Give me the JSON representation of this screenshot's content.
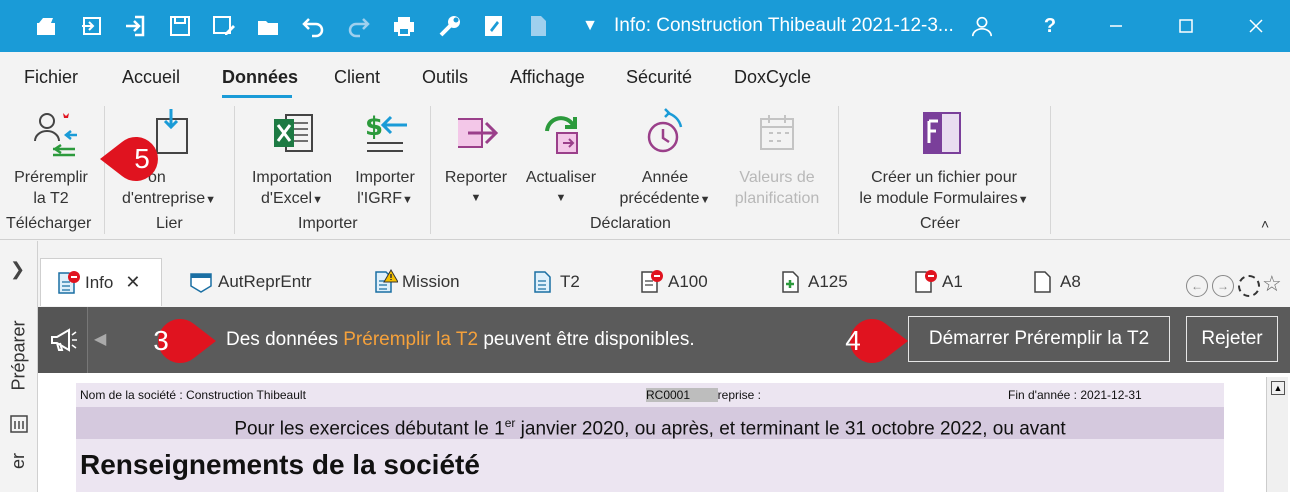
{
  "titlebar": {
    "title": "Info: Construction Thibeault 2021-12-3...",
    "help": "?",
    "accent": "#1a9bd7"
  },
  "menu": {
    "tabs": [
      "Fichier",
      "Accueil",
      "Données",
      "Client",
      "Outils",
      "Affichage",
      "Sécurité",
      "DoxCycle"
    ],
    "active": "Données"
  },
  "ribbon": {
    "preremplir": "Préremplir la T2",
    "telecharger_group": "Télécharger",
    "num_entreprise_line1": "on",
    "num_entreprise_line2": "d'entreprise",
    "lier_group": "Lier",
    "import_excel_line1": "Importation",
    "import_excel_line2": "d'Excel",
    "import_igrf_line1": "Importer",
    "import_igrf_line2": "l'IGRF",
    "importer_group": "Importer",
    "reporter": "Reporter",
    "actualiser": "Actualiser",
    "annee_line1": "Année",
    "annee_line2": "précédente",
    "valeurs_line1": "Valeurs de",
    "valeurs_line2": "planification",
    "declaration_group": "Déclaration",
    "creer_fichier_line1": "Créer un fichier pour",
    "creer_fichier_line2": "le module Formulaires",
    "creer_group": "Créer"
  },
  "leftrail": {
    "label": "Préparer"
  },
  "doctabs": [
    {
      "label": "Info",
      "icon": "doc-error-icon"
    },
    {
      "label": "AutReprEntr",
      "icon": "form-icon"
    },
    {
      "label": "Mission",
      "icon": "doc-warning-icon"
    },
    {
      "label": "T2",
      "icon": "doc-icon"
    },
    {
      "label": "A100",
      "icon": "doc-error-icon"
    },
    {
      "label": "A125",
      "icon": "doc-plus-icon"
    },
    {
      "label": "A1",
      "icon": "doc-error-icon"
    },
    {
      "label": "A8",
      "icon": "doc-icon"
    }
  ],
  "notification": {
    "msg_before": "Des données ",
    "msg_highlight": "Préremplir la T2",
    "msg_after": " peuvent être disponibles.",
    "start_button": "Démarrer Préremplir la T2",
    "reject_button": "Rejeter",
    "highlight_color": "#f5a13b"
  },
  "document": {
    "company_label": "Nom de la société : Construction Thibeault",
    "bn_label": "Numéro d'entreprise :",
    "bn_suffix": "RC0001",
    "yearend_label": "Fin d'année : 2021-12-31",
    "period_before": "Pour les exercices débutant le 1",
    "period_sup": "er",
    "period_after": " janvier 2020, ou après, et terminant le 31 octobre 2022, ou avant",
    "title": "Renseignements de la société"
  },
  "callouts": {
    "c3": "3",
    "c4": "4",
    "c5": "5",
    "color": "#e0131f"
  }
}
